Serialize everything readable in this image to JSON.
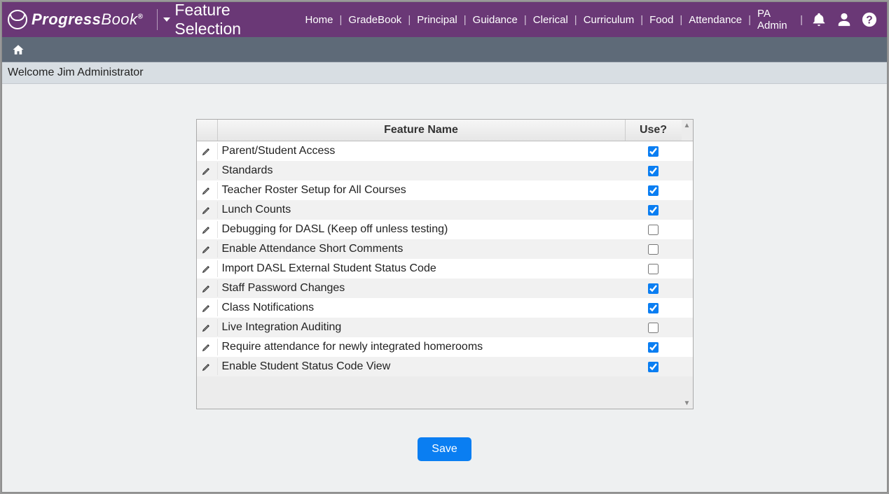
{
  "brand": {
    "name": "ProgressBook"
  },
  "page_title": "Feature Selection",
  "nav": {
    "links": [
      "Home",
      "GradeBook",
      "Principal",
      "Guidance",
      "Clerical",
      "Curriculum",
      "Food",
      "Attendance",
      "PA Admin"
    ]
  },
  "welcome": "Welcome Jim Administrator",
  "grid": {
    "headers": {
      "name": "Feature Name",
      "use": "Use?"
    },
    "rows": [
      {
        "name": "Parent/Student Access",
        "use": true
      },
      {
        "name": "Standards",
        "use": true
      },
      {
        "name": "Teacher Roster Setup for All Courses",
        "use": true
      },
      {
        "name": "Lunch Counts",
        "use": true
      },
      {
        "name": "Debugging for DASL (Keep off unless testing)",
        "use": false
      },
      {
        "name": "Enable Attendance Short Comments",
        "use": false
      },
      {
        "name": "Import DASL External Student Status Code",
        "use": false
      },
      {
        "name": "Staff Password Changes",
        "use": true
      },
      {
        "name": "Class Notifications",
        "use": true
      },
      {
        "name": "Live Integration Auditing",
        "use": false
      },
      {
        "name": "Require attendance for newly integrated homerooms",
        "use": true
      },
      {
        "name": "Enable Student Status Code View",
        "use": true
      }
    ]
  },
  "buttons": {
    "save": "Save"
  }
}
